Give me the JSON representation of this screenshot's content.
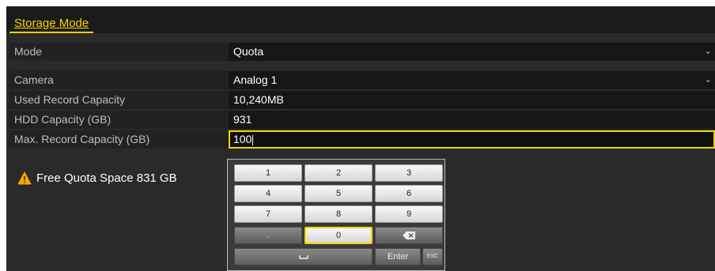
{
  "tab": {
    "label": "Storage Mode"
  },
  "rows": [
    {
      "label": "Mode",
      "value": "Quota"
    },
    {
      "label": "Camera",
      "value": "Analog 1"
    },
    {
      "label": "Used Record Capacity",
      "value": "10,240MB"
    },
    {
      "label": "HDD Capacity (GB)",
      "value": "931"
    },
    {
      "label": "Max. Record Capacity (GB)",
      "value": "100"
    }
  ],
  "warning": {
    "text": "Free Quota Space 831 GB",
    "icon": "warning-triangle-icon",
    "color": "#f6a800"
  },
  "keypad": {
    "keys": [
      "1",
      "2",
      "3",
      "4",
      "5",
      "6",
      "7",
      "8",
      "9",
      ".",
      "0"
    ],
    "backspace_icon": "backspace-icon",
    "space_icon": "space-icon",
    "enter_label": "Enter",
    "esc_label": "ESC"
  },
  "accent_color": "#f6d400"
}
